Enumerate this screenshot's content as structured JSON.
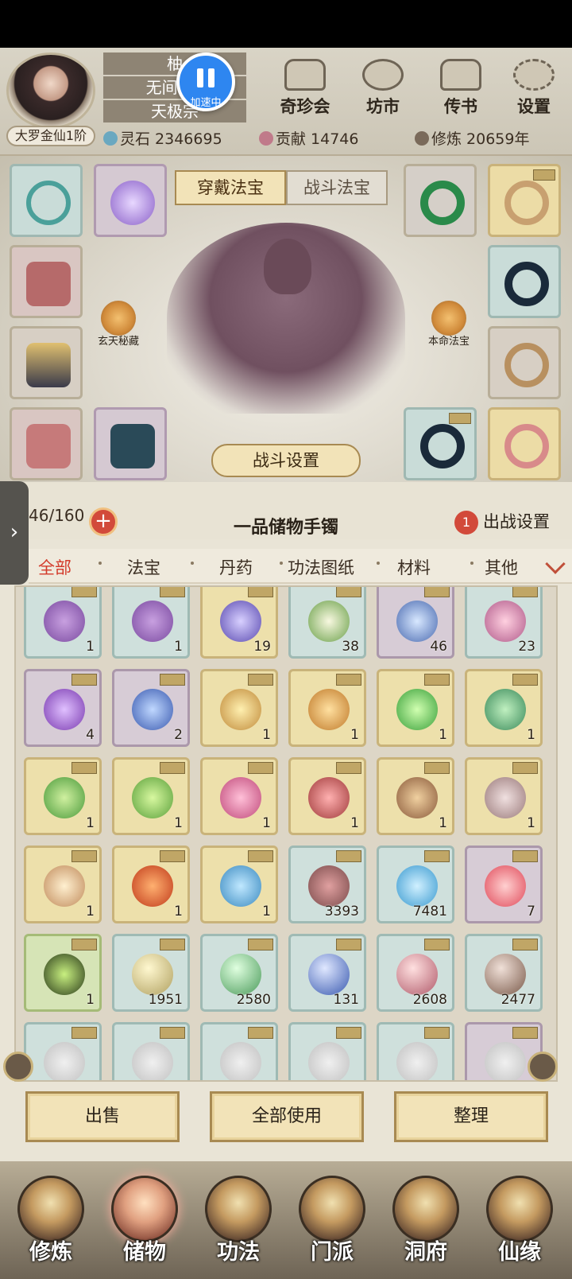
{
  "player": {
    "name_lines": [
      "柚",
      "无间. 碓",
      "天极宗"
    ],
    "rank": "大罗金仙1阶"
  },
  "speed": {
    "label": "加速中"
  },
  "top_nav": [
    {
      "label": "奇珍会",
      "icon": "treasure-pavilion-icon"
    },
    {
      "label": "坊市",
      "icon": "market-icon"
    },
    {
      "label": "传书",
      "icon": "letter-scroll-icon"
    },
    {
      "label": "设置",
      "icon": "gear-icon"
    }
  ],
  "resources": [
    {
      "label": "灵石 2346695",
      "color": "#6aa8c0"
    },
    {
      "label": "贡献 14746",
      "color": "#c07a8a"
    },
    {
      "label": "修炼 20659年",
      "color": "#7a6a5a"
    }
  ],
  "equip_tabs": {
    "wear": "穿戴法宝",
    "battle": "战斗法宝"
  },
  "side_buttons": {
    "left": "玄天秘藏",
    "right": "本命法宝"
  },
  "battle_setting": "战斗设置",
  "bag": {
    "capacity": "46/160",
    "name": "一品储物手镯",
    "deploy_count": "1",
    "deploy_label": "出战设置"
  },
  "filter_tabs": [
    "全部",
    "法宝",
    "丹药",
    "功法图纸",
    "材料",
    "其他"
  ],
  "items": [
    {
      "icon": "grape-pile-icon",
      "count": "1",
      "rarity": "t"
    },
    {
      "icon": "grape-pile-icon",
      "count": "1",
      "rarity": "t"
    },
    {
      "icon": "purple-ore-icon",
      "count": "19",
      "rarity": "y"
    },
    {
      "icon": "white-corn-herb-icon",
      "count": "38",
      "rarity": "t"
    },
    {
      "icon": "blue-corn-herb-icon",
      "count": "46",
      "rarity": "p"
    },
    {
      "icon": "pink-flower-icon",
      "count": "23",
      "rarity": "t"
    },
    {
      "icon": "purple-flower-icon",
      "count": "4",
      "rarity": "p"
    },
    {
      "icon": "blue-flower-icon",
      "count": "2",
      "rarity": "p"
    },
    {
      "icon": "golden-blade-icon",
      "count": "1",
      "rarity": "y"
    },
    {
      "icon": "golden-axe-icon",
      "count": "1",
      "rarity": "y"
    },
    {
      "icon": "green-orb-icon",
      "count": "1",
      "rarity": "y"
    },
    {
      "icon": "jade-sword-icon",
      "count": "1",
      "rarity": "y"
    },
    {
      "icon": "green-umbrella-icon",
      "count": "1",
      "rarity": "y"
    },
    {
      "icon": "green-blade-icon",
      "count": "1",
      "rarity": "y"
    },
    {
      "icon": "pink-ruyi-icon",
      "count": "1",
      "rarity": "y"
    },
    {
      "icon": "red-sword-icon",
      "count": "1",
      "rarity": "y"
    },
    {
      "icon": "bronze-axe-icon",
      "count": "1",
      "rarity": "y"
    },
    {
      "icon": "silver-blade-icon",
      "count": "1",
      "rarity": "y"
    },
    {
      "icon": "cloud-blade-icon",
      "count": "1",
      "rarity": "y"
    },
    {
      "icon": "flame-sword-icon",
      "count": "1",
      "rarity": "y"
    },
    {
      "icon": "blue-ruyi-icon",
      "count": "1",
      "rarity": "y"
    },
    {
      "icon": "red-sand-icon",
      "count": "3393",
      "rarity": "t"
    },
    {
      "icon": "water-drop-icon",
      "count": "7481",
      "rarity": "t"
    },
    {
      "icon": "red-pearl-icon",
      "count": "7",
      "rarity": "p"
    },
    {
      "icon": "green-cauldron-icon",
      "count": "1",
      "rarity": "g"
    },
    {
      "icon": "yellow-bead-icon",
      "count": "1951",
      "rarity": "t"
    },
    {
      "icon": "green-bead-icon",
      "count": "2580",
      "rarity": "t"
    },
    {
      "icon": "blue-bead-icon",
      "count": "131",
      "rarity": "t"
    },
    {
      "icon": "pink-bead-icon",
      "count": "2608",
      "rarity": "t"
    },
    {
      "icon": "brown-bead-icon",
      "count": "2477",
      "rarity": "t"
    },
    {
      "icon": "partial-item-icon",
      "count": "",
      "rarity": "t"
    },
    {
      "icon": "partial-item-icon",
      "count": "",
      "rarity": "t"
    },
    {
      "icon": "partial-item-icon",
      "count": "",
      "rarity": "t"
    },
    {
      "icon": "partial-item-icon",
      "count": "",
      "rarity": "t"
    },
    {
      "icon": "partial-item-icon",
      "count": "",
      "rarity": "t"
    },
    {
      "icon": "partial-item-icon",
      "count": "",
      "rarity": "p"
    }
  ],
  "actions": {
    "sell": "出售",
    "use_all": "全部使用",
    "sort": "整理"
  },
  "bottom_nav": [
    {
      "label": "修炼",
      "icon": "meditation-icon"
    },
    {
      "label": "储物",
      "icon": "storage-bag-icon"
    },
    {
      "label": "功法",
      "icon": "scroll-icon"
    },
    {
      "label": "门派",
      "icon": "sect-gate-icon"
    },
    {
      "label": "洞府",
      "icon": "cave-mountain-icon"
    },
    {
      "label": "仙缘",
      "icon": "fate-swirl-icon"
    }
  ]
}
